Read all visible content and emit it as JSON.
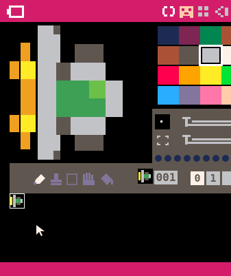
{
  "colors": {
    "topbar": "#d41d6a",
    "panel": "#5f574f",
    "dark": "#000000",
    "grey": "#c2c3c7",
    "yellow": "#ffec27",
    "orange": "#f0a020",
    "green": "#3ea055",
    "lightgreen": "#6cc04a",
    "darkgrey": "#5f574f",
    "white": "#fff1e8",
    "lavender": "#83769c"
  },
  "palette": [
    "#1d2b53",
    "#7e2553",
    "#008751",
    "#ab5236",
    "#5f574f",
    "#c2c3c7",
    "#fff1e8",
    "#ff004d",
    "#ffa300",
    "#ffec27",
    "#00e436",
    "#29adff",
    "#83769c",
    "#ff77a8",
    "#ffccaa",
    "#000000"
  ],
  "toolbar": {
    "sprite_number": "001",
    "tab_a": "0",
    "tab_b": "1"
  },
  "icons": [
    "code-icon",
    "sprite-icon",
    "map-icon",
    "sfx-icon",
    "pencil-icon",
    "stamp-icon",
    "select-icon",
    "hand-icon",
    "fill-icon",
    "brush-size-icon",
    "zoom-icon"
  ]
}
